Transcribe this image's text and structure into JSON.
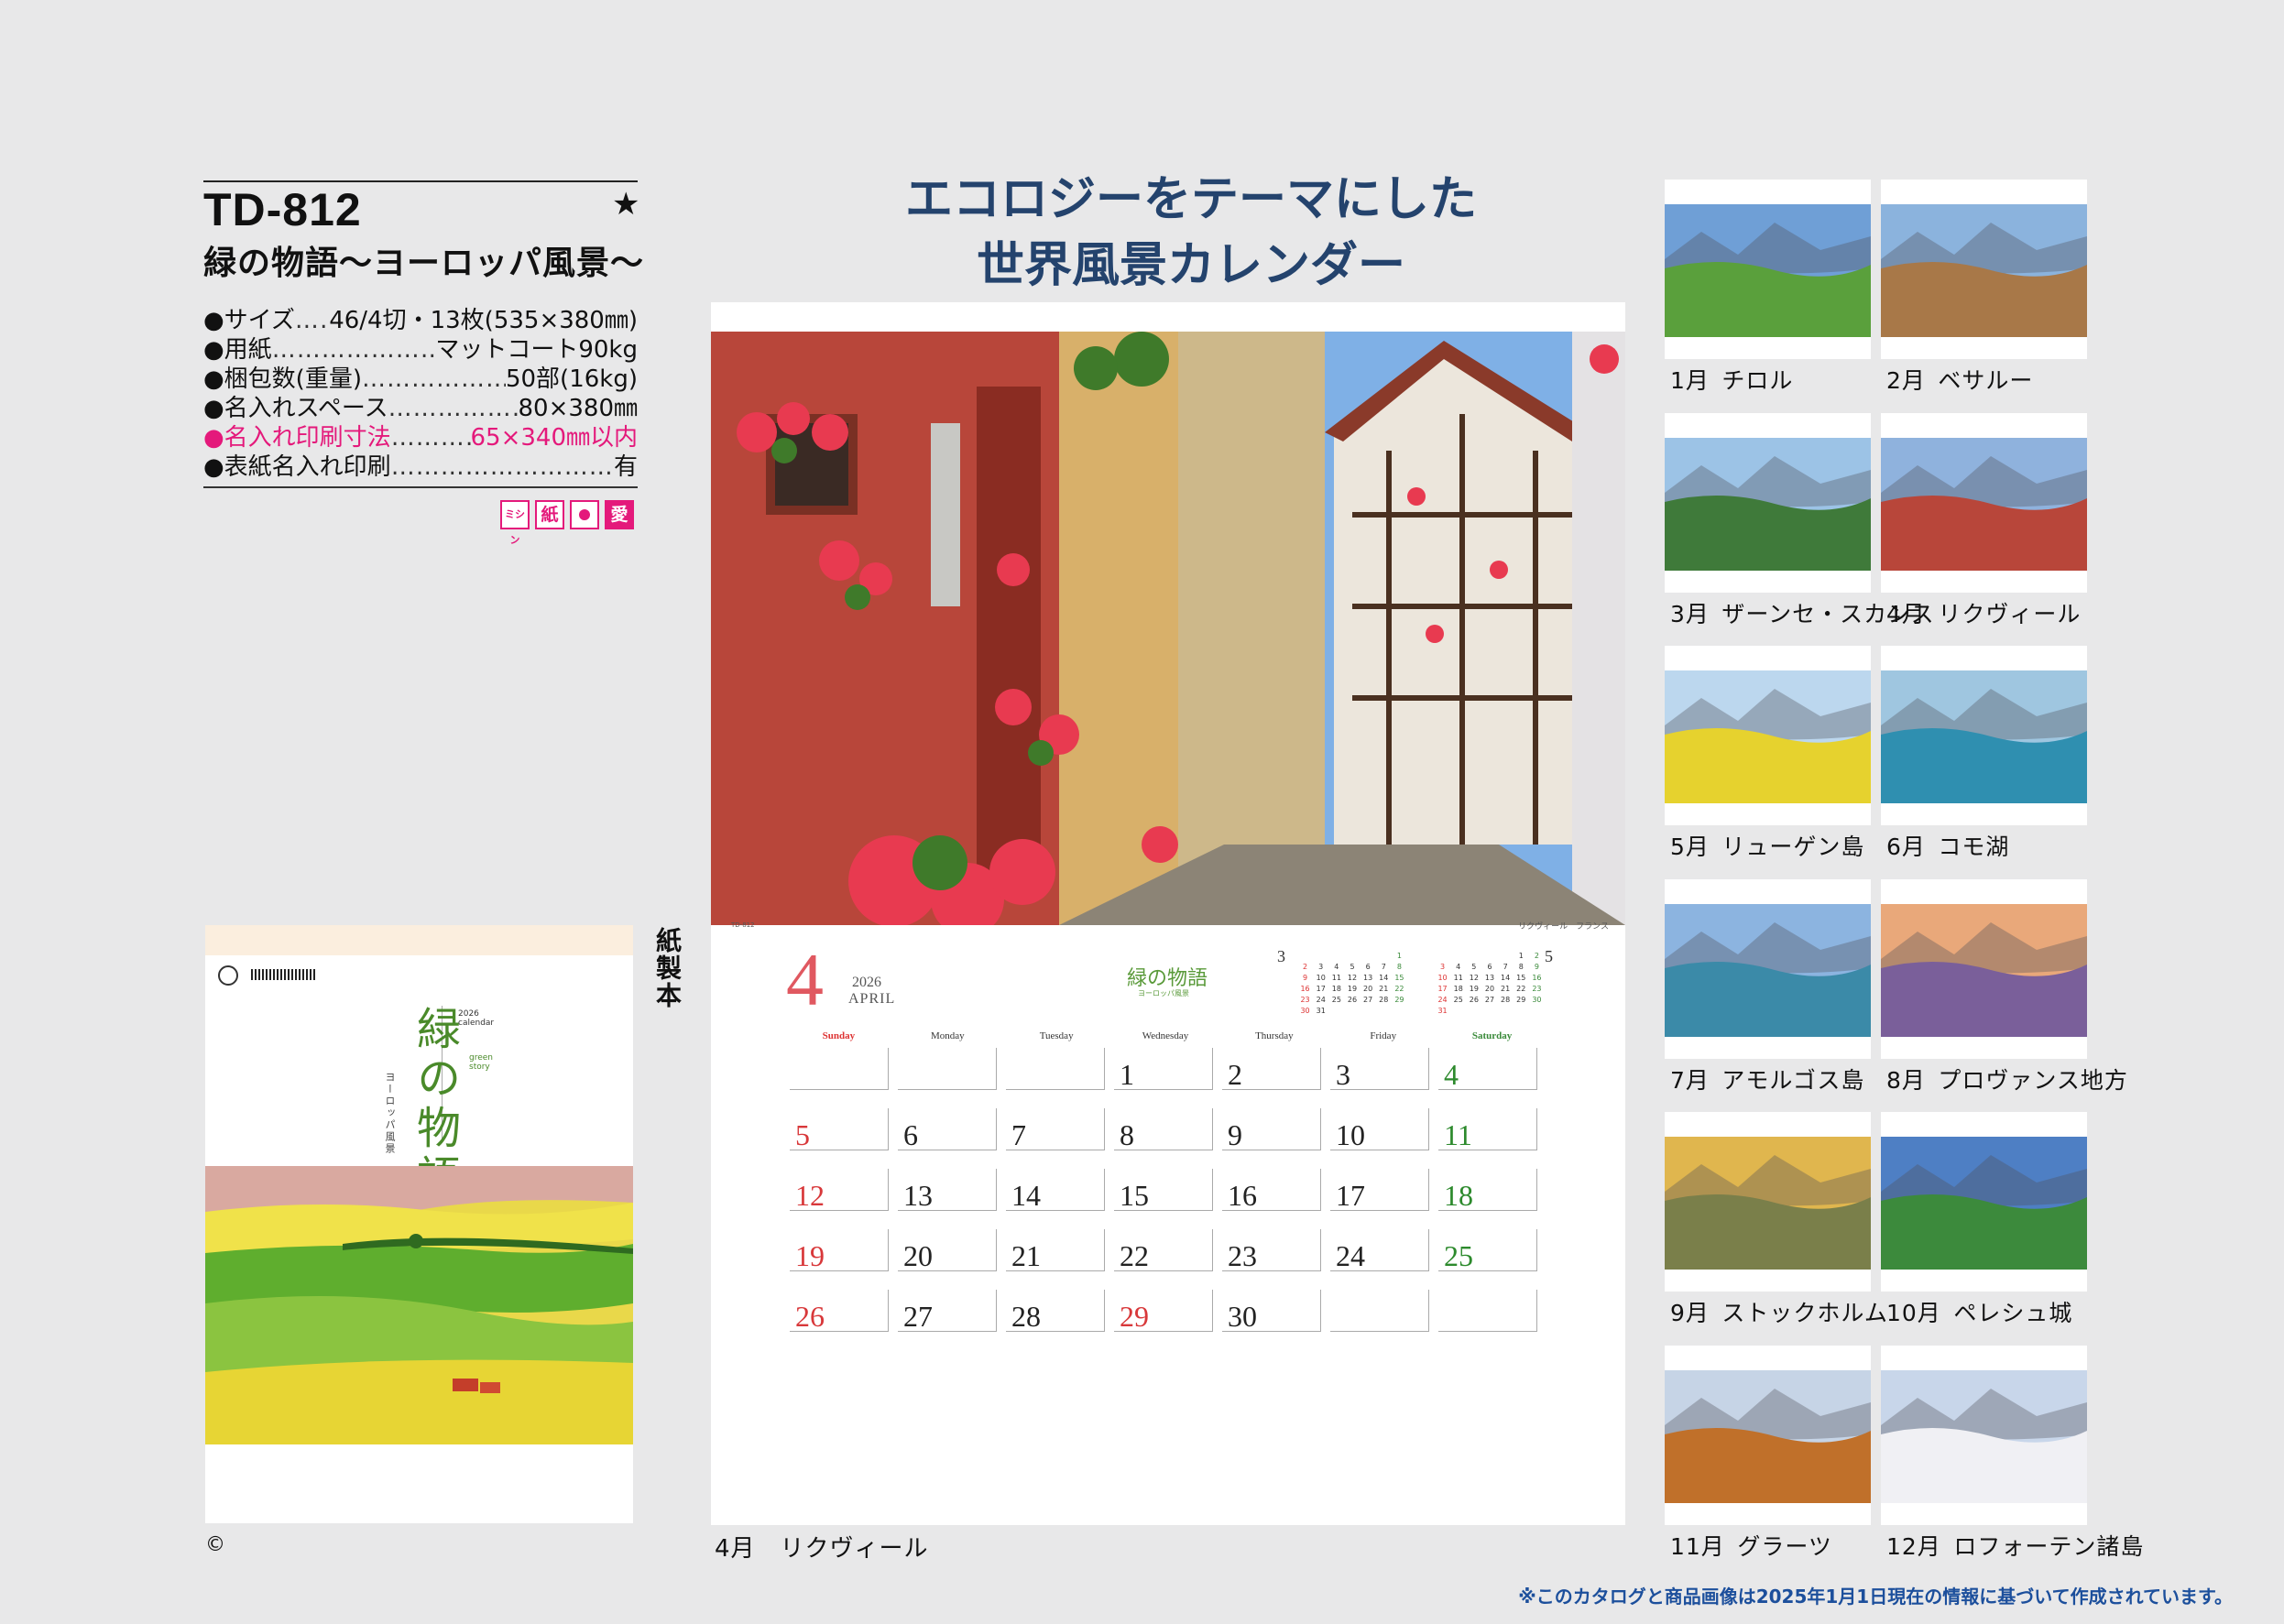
{
  "product": {
    "code": "TD-812",
    "star": "★",
    "title": "緑の物語〜ヨーロッパ風景〜",
    "specs": [
      {
        "label": "●サイズ",
        "value": "46/4切・13枚(535×380㎜)",
        "pink": false
      },
      {
        "label": "●用紙",
        "value": "マットコート90kg",
        "pink": false
      },
      {
        "label": "●梱包数(重量)",
        "value": "50部(16kg)",
        "pink": false
      },
      {
        "label": "●名入れスペース",
        "value": "80×380㎜",
        "pink": false
      },
      {
        "label": "●名入れ印刷寸法",
        "value": "65×340㎜以内",
        "pink": true
      },
      {
        "label": "●表紙名入れ印刷",
        "value": "有",
        "pink": false
      }
    ],
    "badges": [
      "ミシン",
      "紙",
      "",
      "愛"
    ],
    "binding_label": "紙製本"
  },
  "cover": {
    "title": "緑の物語",
    "subtitle": "ヨーロッパ風景",
    "year_text": "2026 calendar",
    "green_text": "green story"
  },
  "copyright": "©",
  "headline": {
    "line1": "エコロジーをテーマにした",
    "line2": "世界風景カレンダー"
  },
  "sheet": {
    "photo_location": "リクヴィール　フランス",
    "code_small": "TD-812",
    "month": "4",
    "year": "2026",
    "month_english": "APRIL",
    "brand": "緑の物語",
    "brand_sub": "ヨーロッパ風景",
    "weekdays": [
      "Sunday",
      "Monday",
      "Tuesday",
      "Wednesday",
      "Thursday",
      "Friday",
      "Saturday"
    ],
    "days": [
      "",
      "",
      "",
      "1",
      "2",
      "3",
      "4",
      "5",
      "6",
      "7",
      "8",
      "9",
      "10",
      "11",
      "12",
      "13",
      "14",
      "15",
      "16",
      "17",
      "18",
      "19",
      "20",
      "21",
      "22",
      "23",
      "24",
      "25",
      "26",
      "27",
      "28",
      "29",
      "30",
      "",
      ""
    ],
    "holidays": [
      "29"
    ],
    "prev_month": {
      "num": "3",
      "days": [
        "",
        "",
        "",
        "",
        "",
        "",
        "1",
        "2",
        "3",
        "4",
        "5",
        "6",
        "7",
        "8",
        "9",
        "10",
        "11",
        "12",
        "13",
        "14",
        "15",
        "16",
        "17",
        "18",
        "19",
        "20",
        "21",
        "22",
        "23",
        "24",
        "25",
        "26",
        "27",
        "28",
        "29",
        "30",
        "31"
      ]
    },
    "next_month": {
      "num": "5",
      "days": [
        "",
        "",
        "",
        "",
        "",
        "1",
        "2",
        "3",
        "4",
        "5",
        "6",
        "7",
        "8",
        "9",
        "10",
        "11",
        "12",
        "13",
        "14",
        "15",
        "16",
        "17",
        "18",
        "19",
        "20",
        "21",
        "22",
        "23",
        "24",
        "25",
        "26",
        "27",
        "28",
        "29",
        "30",
        "31"
      ]
    },
    "caption": "4月　リクヴィール"
  },
  "thumbnails": [
    {
      "month": "1月",
      "place": "チロル",
      "sky": "#6f9fd6",
      "land": "#5aa03c"
    },
    {
      "month": "2月",
      "place": "ベサルー",
      "sky": "#8bb3dd",
      "land": "#a87848"
    },
    {
      "month": "3月",
      "place": "ザーンセ・スカンス",
      "sky": "#9cc3e6",
      "land": "#3f7a3a"
    },
    {
      "month": "4月",
      "place": "リクヴィール",
      "sky": "#8fb2dd",
      "land": "#b8463a"
    },
    {
      "month": "5月",
      "place": "リューゲン島",
      "sky": "#bcd7ee",
      "land": "#e6d22e"
    },
    {
      "month": "6月",
      "place": "コモ湖",
      "sky": "#9fc6e0",
      "land": "#2f8fb0"
    },
    {
      "month": "7月",
      "place": "アモルゴス島",
      "sky": "#8cb4e0",
      "land": "#3b8aa8"
    },
    {
      "month": "8月",
      "place": "プロヴァンス地方",
      "sky": "#e9a87a",
      "land": "#7a5f9a"
    },
    {
      "month": "9月",
      "place": "ストックホルム",
      "sky": "#e0b64e",
      "land": "#7a7f4a"
    },
    {
      "month": "10月",
      "place": "ペレシュ城",
      "sky": "#4e7fc4",
      "land": "#3c8a3c"
    },
    {
      "month": "11月",
      "place": "グラーツ",
      "sky": "#c6d4e6",
      "land": "#c0702a"
    },
    {
      "month": "12月",
      "place": "ロフォーテン諸島",
      "sky": "#c8d6ea",
      "land": "#f0f0f4"
    }
  ],
  "footer": "※このカタログと商品画像は2025年1月1日現在の情報に基づいて作成されています。"
}
